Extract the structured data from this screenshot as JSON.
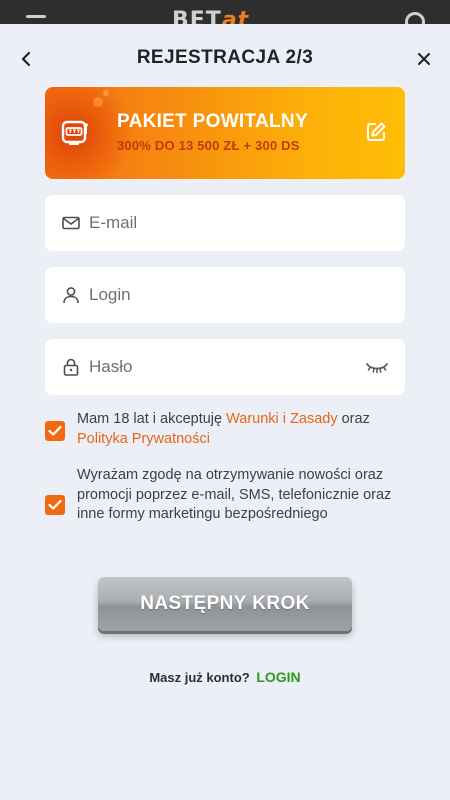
{
  "topbar": {
    "logo_text": "BET",
    "logo_accent": "at"
  },
  "header": {
    "title": "REJESTRACJA 2/3"
  },
  "promo": {
    "title": "PAKIET POWITALNY",
    "subtitle": "300% DO 13 500 ZŁ + 300 DS"
  },
  "form": {
    "email_placeholder": "E-mail",
    "login_placeholder": "Login",
    "password_placeholder": "Hasło"
  },
  "consents": [
    {
      "checked": true,
      "text_before": "Mam 18 lat i akceptuję ",
      "link1": "Warunki i Zasady",
      "text_mid": " oraz ",
      "link2": "Polityka Prywatności"
    },
    {
      "checked": true,
      "text": "Wyrażam zgodę na otrzymywanie nowości oraz promocji poprzez e-mail, SMS, telefonicznie oraz inne formy marketingu bezpośredniego"
    }
  ],
  "next_button": {
    "label": "NASTĘPNY KROK"
  },
  "footer": {
    "question": "Masz już konto?",
    "login_link": "LOGIN"
  },
  "colors": {
    "accent": "#f06a13",
    "link": "#e9641b",
    "login_green": "#2b9a1f",
    "background": "#ecf0f6"
  }
}
